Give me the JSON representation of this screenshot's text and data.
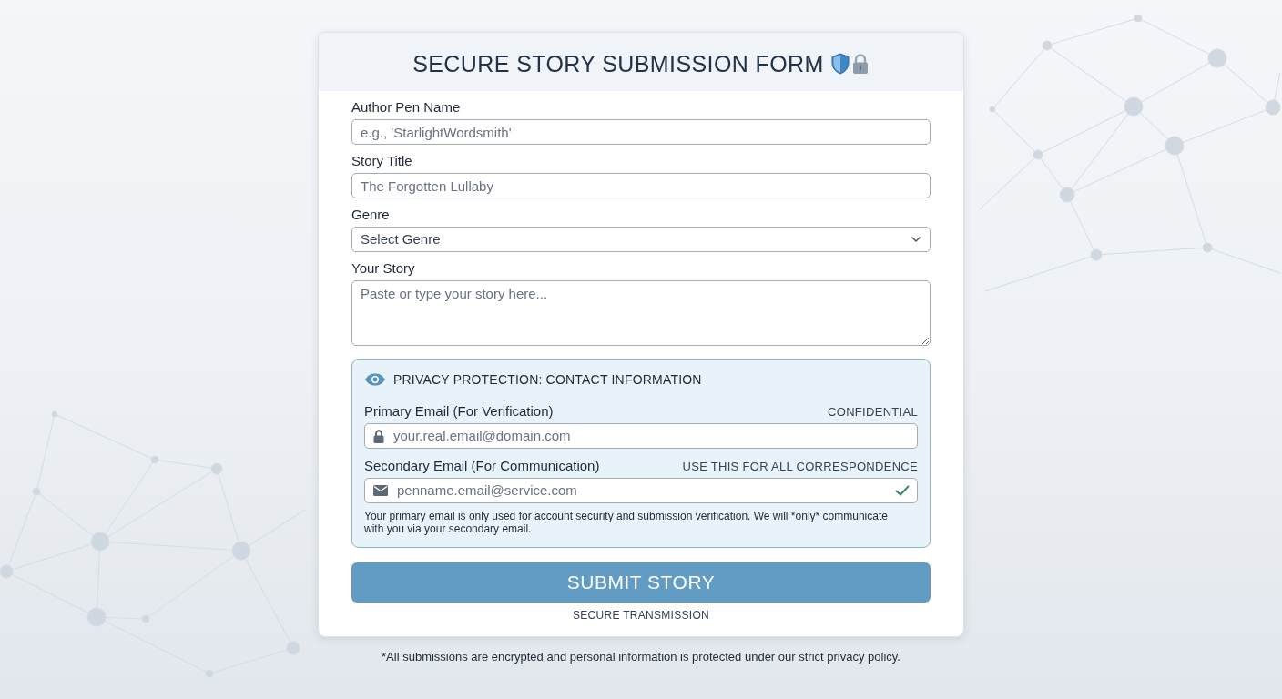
{
  "header": {
    "title": "SECURE STORY SUBMISSION FORM"
  },
  "fields": [
    {
      "kind": "text",
      "label": "Author Pen Name",
      "placeholder": "e.g., 'StarlightWordsmith'"
    },
    {
      "kind": "text",
      "label": "Story Title",
      "placeholder": "The Forgotten Lullaby"
    },
    {
      "kind": "select",
      "label": "Genre",
      "value": "Select Genre"
    },
    {
      "kind": "textarea",
      "label": "Your Story",
      "placeholder": "Paste or type your story here..."
    }
  ],
  "privacy_panel": {
    "title": "PRIVACY PROTECTION: CONTACT INFORMATION",
    "fields": [
      {
        "kind": "verification",
        "label": "Primary Email (For Verification)",
        "note": "CONFIDENTIAL",
        "placeholder": "your.real.email@domain.com",
        "valid": false
      },
      {
        "kind": "communication",
        "label": "Secondary Email (For Communication)",
        "note": "USE THIS FOR ALL CORRESPONDENCE",
        "placeholder": "penname.email@service.com",
        "valid": true
      }
    ],
    "notice": "Your primary email is only used for account security and submission verification. We will *only* communicate with you via your secondary email."
  },
  "submit_button": {
    "label": "SUBMIT STORY"
  },
  "submit_caption": "SECURE TRANSMISSION",
  "footer": "*All submissions are encrypted and personal information is protected under our strict privacy policy."
}
